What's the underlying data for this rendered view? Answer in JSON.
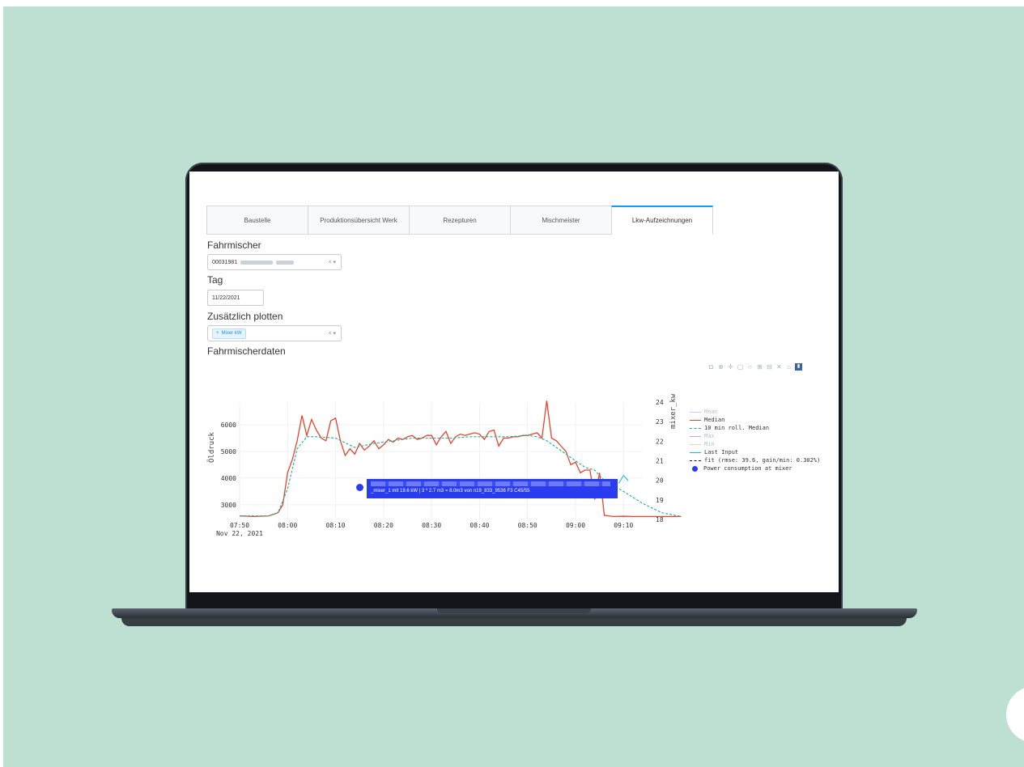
{
  "tabs": [
    "Baustelle",
    "Produktionsübersicht Werk",
    "Rezepturen",
    "Mischmeister",
    "Lkw-Aufzeichnungen"
  ],
  "active_tab": "Lkw-Aufzeichnungen",
  "fahrmischer": {
    "label": "Fahrmischer",
    "value": "00031981",
    "controls": "× ▾"
  },
  "tag": {
    "label": "Tag",
    "value": "11/22/2021"
  },
  "plotten": {
    "label": "Zusätzlich plotten",
    "chip": "Mixer kW",
    "chip_x": "×",
    "controls": "× ▾"
  },
  "section_title": "Fahrmischerdaten",
  "modebar_icons": [
    "camera-icon",
    "zoom-icon",
    "pan-icon",
    "box-select-icon",
    "lasso-icon",
    "zoom-in-icon",
    "zoom-out-icon",
    "autoscale-icon",
    "reset-icon",
    "plotly-logo-icon"
  ],
  "tooltip": {
    "line2": "_mixer_1 mit  19.6 kW  |  3 * 2.7 m3 = 8.0m3 von n19_833_9536 F3 C45/55"
  },
  "legend": [
    {
      "name": "Mean",
      "color": "#b9d6e6",
      "faded": true
    },
    {
      "name": "Median",
      "color": "#e8432a",
      "faded": false
    },
    {
      "name": "10 min roll. Median",
      "color": "#1aaea0",
      "faded": false,
      "dash": true
    },
    {
      "name": "Max",
      "color": "#c9a8d6",
      "faded": true
    },
    {
      "name": "Min",
      "color": "#f0d2a8",
      "faded": true
    },
    {
      "name": "Last Input",
      "color": "#1fb6e6",
      "faded": false
    },
    {
      "name": "fit (rmse: 39.6, gain/min: 0.302%)",
      "color": "#111111",
      "faded": false,
      "dash": true
    },
    {
      "name": "Power consumption at mixer",
      "color": "#2a3cf0",
      "faded": false,
      "dot": true
    }
  ],
  "chart_data": {
    "type": "line",
    "ylabel": "Öldruck",
    "y2label": "mixer_kw",
    "x_ticks": [
      "07:50",
      "08:00",
      "08:10",
      "08:20",
      "08:30",
      "08:40",
      "08:50",
      "09:00",
      "09:10"
    ],
    "x_subtick": "Nov 22, 2021",
    "y_ticks": [
      3000,
      4000,
      5000,
      6000
    ],
    "y2_ticks": [
      18,
      19,
      20,
      21,
      22,
      23,
      24
    ],
    "ylim": [
      2450,
      6850
    ],
    "y2lim": [
      18,
      24
    ],
    "grid": true,
    "series": [
      {
        "name": "Median",
        "color": "#e8432a",
        "x_minutes": [
          0,
          3,
          6,
          8,
          9,
          10,
          11,
          12,
          13,
          14,
          15,
          16,
          17,
          18,
          19,
          20,
          21,
          22,
          23,
          24,
          25,
          26,
          27,
          28,
          29,
          30,
          31,
          32,
          33,
          34,
          35,
          36,
          37,
          38,
          39,
          40,
          41,
          42,
          43,
          44,
          45,
          46,
          47,
          48,
          49,
          50,
          51,
          52,
          53,
          54,
          55,
          56,
          57,
          58,
          59,
          60,
          61,
          62,
          63,
          64,
          65,
          66,
          67,
          68,
          69,
          70,
          71,
          72,
          73,
          74,
          75,
          76,
          77,
          78,
          80,
          82,
          84,
          86,
          88,
          90,
          92
        ],
        "values": [
          2580,
          2560,
          2580,
          2700,
          3000,
          4200,
          4700,
          5400,
          6350,
          5600,
          6200,
          5800,
          5500,
          5400,
          6150,
          6250,
          5400,
          4850,
          5100,
          4900,
          5300,
          5050,
          5200,
          5400,
          5100,
          5250,
          5450,
          5350,
          5500,
          5450,
          5550,
          5600,
          5450,
          5500,
          5600,
          5600,
          5250,
          5550,
          5750,
          5300,
          5550,
          5650,
          5600,
          5650,
          5700,
          5650,
          5450,
          5750,
          5800,
          5200,
          5500,
          5500,
          5550,
          5550,
          5600,
          5600,
          5650,
          5700,
          5500,
          6900,
          5500,
          5400,
          5200,
          5000,
          4500,
          4600,
          4200,
          4300,
          4300,
          3200,
          4200,
          2600,
          2580,
          2560,
          2570,
          2560,
          2560,
          2560,
          2560,
          2560,
          2560
        ]
      },
      {
        "name": "10 min roll. Median",
        "color": "#1aaea0",
        "x_minutes": [
          0,
          6,
          8,
          10,
          12,
          14,
          16,
          20,
          24,
          28,
          32,
          36,
          40,
          44,
          48,
          52,
          56,
          60,
          62,
          64,
          66,
          68,
          70,
          72,
          74,
          76,
          80,
          84,
          88,
          92
        ],
        "values": [
          2580,
          2580,
          2700,
          3600,
          5100,
          5550,
          5550,
          5500,
          5150,
          5300,
          5400,
          5500,
          5500,
          5500,
          5550,
          5550,
          5550,
          5600,
          5550,
          5400,
          5150,
          4900,
          4650,
          4400,
          4300,
          3900,
          3500,
          3050,
          2700,
          2560
        ]
      },
      {
        "name": "Last Input",
        "color": "#1fb6e6",
        "x_minutes": [
          79,
          80,
          81
        ],
        "values": [
          3800,
          4100,
          3900
        ]
      }
    ],
    "point": {
      "name": "Power consumption at mixer",
      "x_minute": 25,
      "value_kw": 19.6
    }
  }
}
